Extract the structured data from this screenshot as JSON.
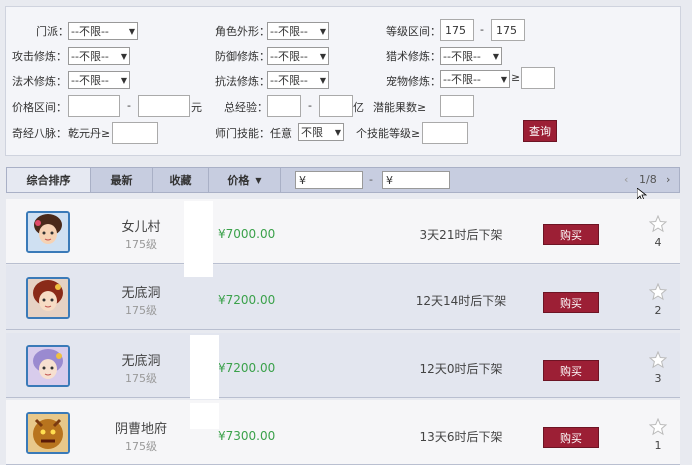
{
  "filters": {
    "menpai": {
      "label": "门派：",
      "value": "--不限--"
    },
    "appearance": {
      "label": "角色外形：",
      "value": "--不限--"
    },
    "level_range": {
      "label": "等级区间：",
      "min": "175",
      "max": "175",
      "sep": "-"
    },
    "attack_cult": {
      "label": "攻击修炼：",
      "value": "--不限--"
    },
    "defense_cult": {
      "label": "防御修炼：",
      "value": "--不限--"
    },
    "hunt_cult": {
      "label": "猎术修炼：",
      "value": "--不限--"
    },
    "magic_cult": {
      "label": "法术修炼：",
      "value": "--不限--"
    },
    "resist_cult": {
      "label": "抗法修炼：",
      "value": "--不限--"
    },
    "pet_cult": {
      "label": "宠物修炼：",
      "value": "--不限--",
      "suffix": "≥"
    },
    "price_range": {
      "label": "价格区间：",
      "sep": "-",
      "unit": "元"
    },
    "experience": {
      "label": "总经验：",
      "sep": "-",
      "unit": "亿"
    },
    "potential": {
      "label": "潜能果数≥"
    },
    "meridian": {
      "label": "奇经八脉：",
      "item": "乾元丹≥"
    },
    "school_skill": {
      "label": "师门技能：",
      "any": "任意",
      "value": "不限",
      "skill_level": "个技能等级≥"
    },
    "search_button": "查询"
  },
  "sortbar": {
    "tabs": [
      "综合排序",
      "最新",
      "收藏",
      "价格"
    ],
    "price_from": "¥",
    "price_sep": "-",
    "price_to": "¥",
    "pager_prev": "‹",
    "page": "1/8",
    "pager_next": "›"
  },
  "listings": [
    {
      "school": "女儿村",
      "level": "175级",
      "price": "¥7000.00",
      "time": "3天21时后下架",
      "buy": "购买",
      "favs": "4"
    },
    {
      "school": "无底洞",
      "level": "175级",
      "price": "¥7200.00",
      "time": "12天14时后下架",
      "buy": "购买",
      "favs": "2"
    },
    {
      "school": "无底洞",
      "level": "175级",
      "price": "¥7200.00",
      "time": "12天0时后下架",
      "buy": "购买",
      "favs": "3"
    },
    {
      "school": "阴曹地府",
      "level": "175级",
      "price": "¥7300.00",
      "time": "13天6时后下架",
      "buy": "购买",
      "favs": "1"
    }
  ],
  "colors": {
    "accent": "#9c1f35",
    "price": "#3aa14a",
    "sortbar": "#c7cde0"
  }
}
